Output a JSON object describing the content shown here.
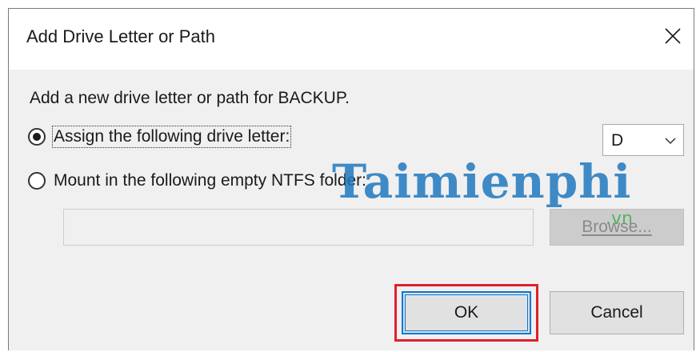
{
  "dialog": {
    "title": "Add Drive Letter or Path",
    "close_icon": "close-icon"
  },
  "description": "Add a new drive letter or path for BACKUP.",
  "options": {
    "assign_label": "Assign the following drive letter:",
    "assign_selected": true,
    "mount_label": "Mount in the following empty NTFS folder:",
    "mount_selected": false
  },
  "drive_letter": {
    "value": "D",
    "icon": "chevron-down-icon"
  },
  "folder_path": {
    "value": ""
  },
  "buttons": {
    "browse_label": "Browse...",
    "ok_label": "OK",
    "cancel_label": "Cancel"
  },
  "watermark": {
    "brand": "Taimienphi",
    "suffix": ".vn"
  },
  "colors": {
    "focus_blue": "#0078d7",
    "highlight_red": "#e0202a",
    "dialog_bg": "#f0f0f0"
  }
}
